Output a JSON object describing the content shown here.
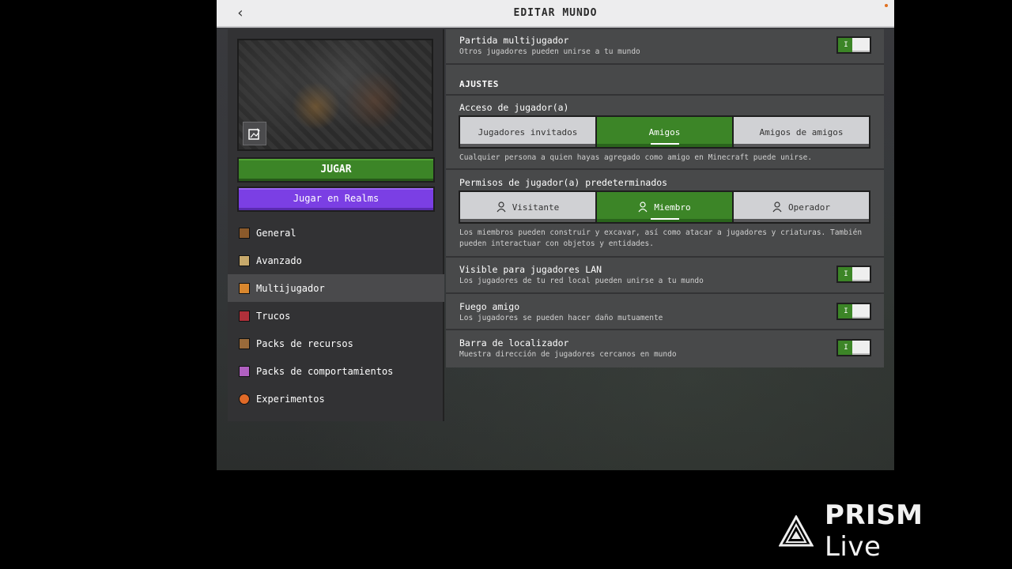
{
  "header": {
    "title": "EDITAR MUNDO",
    "back_icon": "chevron-left-icon"
  },
  "left": {
    "play_label": "JUGAR",
    "realms_label": "Jugar en Realms",
    "nav": [
      {
        "label": "General",
        "icon": "general-icon",
        "color": "#8b5a2b"
      },
      {
        "label": "Avanzado",
        "icon": "advanced-icon",
        "color": "#c7a96b"
      },
      {
        "label": "Multijugador",
        "icon": "multiplayer-icon",
        "color": "#d9872e",
        "active": true
      },
      {
        "label": "Trucos",
        "icon": "cheats-icon",
        "color": "#b0303a"
      },
      {
        "label": "Packs de recursos",
        "icon": "resource-packs-icon",
        "color": "#9a6a3a"
      },
      {
        "label": "Packs de comportamientos",
        "icon": "behavior-packs-icon",
        "color": "#b060c0"
      },
      {
        "label": "Experimentos",
        "icon": "experiments-icon",
        "color": "#e06a28"
      }
    ]
  },
  "right": {
    "multiplayer": {
      "title": "Partida multijugador",
      "sub": "Otros jugadores pueden unirse a tu mundo",
      "on": true
    },
    "section": "AJUSTES",
    "access": {
      "title": "Acceso de jugador(a)",
      "options": [
        "Jugadores invitados",
        "Amigos",
        "Amigos de amigos"
      ],
      "selected": "Amigos",
      "desc": "Cualquier persona a quien hayas agregado como amigo en Minecraft puede unirse."
    },
    "permissions": {
      "title": "Permisos de jugador(a) predeterminados",
      "options": [
        "Visitante",
        "Miembro",
        "Operador"
      ],
      "selected": "Miembro",
      "desc": "Los miembros pueden construir y excavar, así como atacar a jugadores y criaturas. También pueden interactuar con objetos y entidades."
    },
    "lan": {
      "title": "Visible para jugadores LAN",
      "sub": "Los jugadores de tu red local pueden unirse a tu mundo",
      "on": true
    },
    "friendly_fire": {
      "title": "Fuego amigo",
      "sub": "Los jugadores se pueden hacer daño mutuamente",
      "on": true
    },
    "locator": {
      "title": "Barra de localizador",
      "sub": "Muestra dirección de jugadores cercanos en mundo",
      "on": true
    },
    "toggle_on_glyph": "I"
  },
  "watermark": {
    "brand": "PRISM",
    "suffix": "Live"
  },
  "colors": {
    "green": "#3c8527",
    "purple": "#7b3fe4"
  }
}
